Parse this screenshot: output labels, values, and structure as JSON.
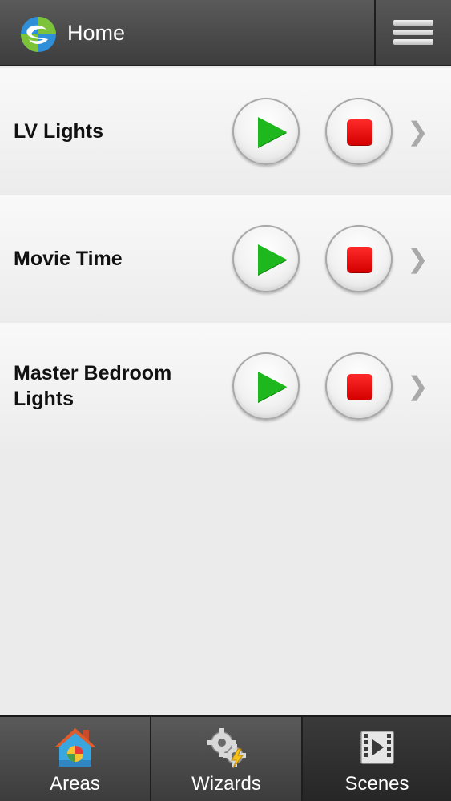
{
  "header": {
    "title": "Home",
    "logo_icon": "app-globe-logo",
    "menu_icon": "hamburger-menu-icon"
  },
  "scenes": [
    {
      "name": "LV Lights"
    },
    {
      "name": "Movie Time"
    },
    {
      "name": "Master Bedroom Lights"
    }
  ],
  "tabs": [
    {
      "label": "Areas",
      "icon": "house-icon",
      "active": false
    },
    {
      "label": "Wizards",
      "icon": "gears-lightning-icon",
      "active": false
    },
    {
      "label": "Scenes",
      "icon": "film-strip-icon",
      "active": true
    }
  ],
  "colors": {
    "play": "#1eb81e",
    "stop": "#e60000",
    "header": "#4a4a4a"
  }
}
